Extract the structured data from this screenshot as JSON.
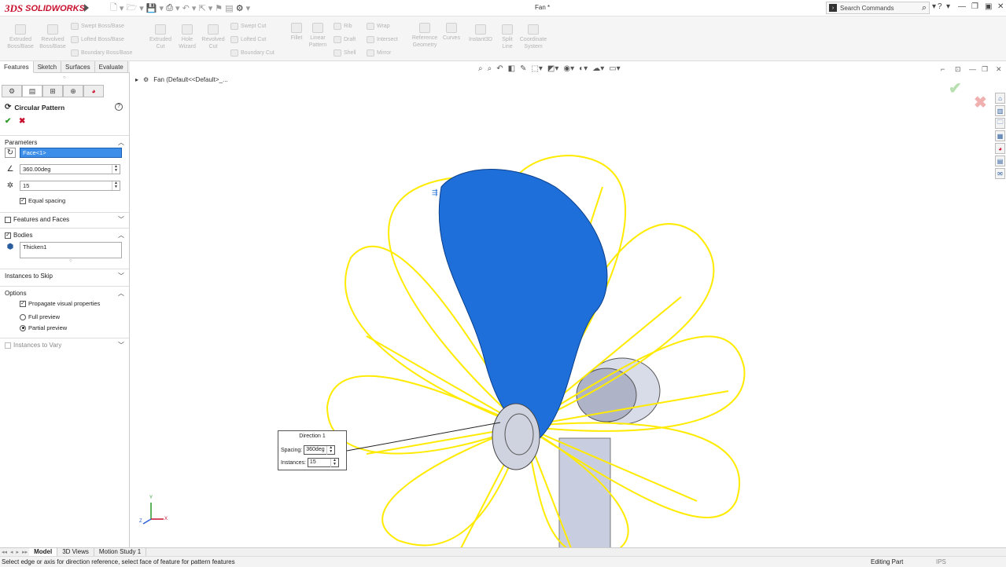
{
  "titlebar": {
    "brand_ds": "3DS",
    "brand_name": "SOLIDWORKS",
    "doc_title": "Fan *",
    "search_placeholder": "Search Commands",
    "help": "?"
  },
  "ribbon": {
    "large": [
      {
        "label": "Extruded Boss/Base"
      },
      {
        "label": "Revolved Boss/Base"
      },
      {
        "label": "Extruded Cut"
      },
      {
        "label": "Hole Wizard"
      },
      {
        "label": "Revolved Cut"
      },
      {
        "label": "Fillet"
      },
      {
        "label": "Linear Pattern"
      },
      {
        "label": "Reference Geometry"
      },
      {
        "label": "Curves"
      },
      {
        "label": "Instant3D"
      },
      {
        "label": "Split Line"
      },
      {
        "label": "Coordinate System"
      }
    ],
    "small": [
      "Swept Boss/Base",
      "Lofted Boss/Base",
      "Boundary Boss/Base",
      "Swept Cut",
      "Lofted Cut",
      "Boundary Cut",
      "Rib",
      "Draft",
      "Shell",
      "Wrap",
      "Intersect",
      "Mirror"
    ]
  },
  "tabs": [
    "Features",
    "Sketch",
    "Surfaces",
    "Evaluate"
  ],
  "pm": {
    "title": "Circular Pattern",
    "sections": {
      "parameters": "Parameters",
      "features_faces": "Features and Faces",
      "bodies": "Bodies",
      "skip": "Instances to Skip",
      "options": "Options",
      "vary": "Instances to Vary"
    },
    "direction_ref": "Face<1>",
    "angle": "360.00deg",
    "instances": "15",
    "equal_spacing": "Equal spacing",
    "body": "Thicken1",
    "propagate": "Propagate visual properties",
    "full_preview": "Full preview",
    "partial_preview": "Partial preview"
  },
  "viewport": {
    "tree_label": "Fan  (Default<<Default>_...",
    "callout": {
      "title": "Direction 1",
      "spacing_label": "Spacing:",
      "spacing": "360deg",
      "instances_label": "Instances:",
      "instances": "15"
    },
    "triad": {
      "x": "X",
      "y": "Y",
      "z": "Z"
    }
  },
  "bottom_tabs": [
    "Model",
    "3D Views",
    "Motion Study 1"
  ],
  "status": {
    "message": "Select edge or axis for direction reference, select face of feature for pattern features",
    "mode": "Editing Part",
    "units": "IPS"
  },
  "colors": {
    "brand": "#c8102e",
    "blade": "#1e6fd9",
    "preview": "#ffeb00",
    "selection": "#3d8ee8"
  }
}
